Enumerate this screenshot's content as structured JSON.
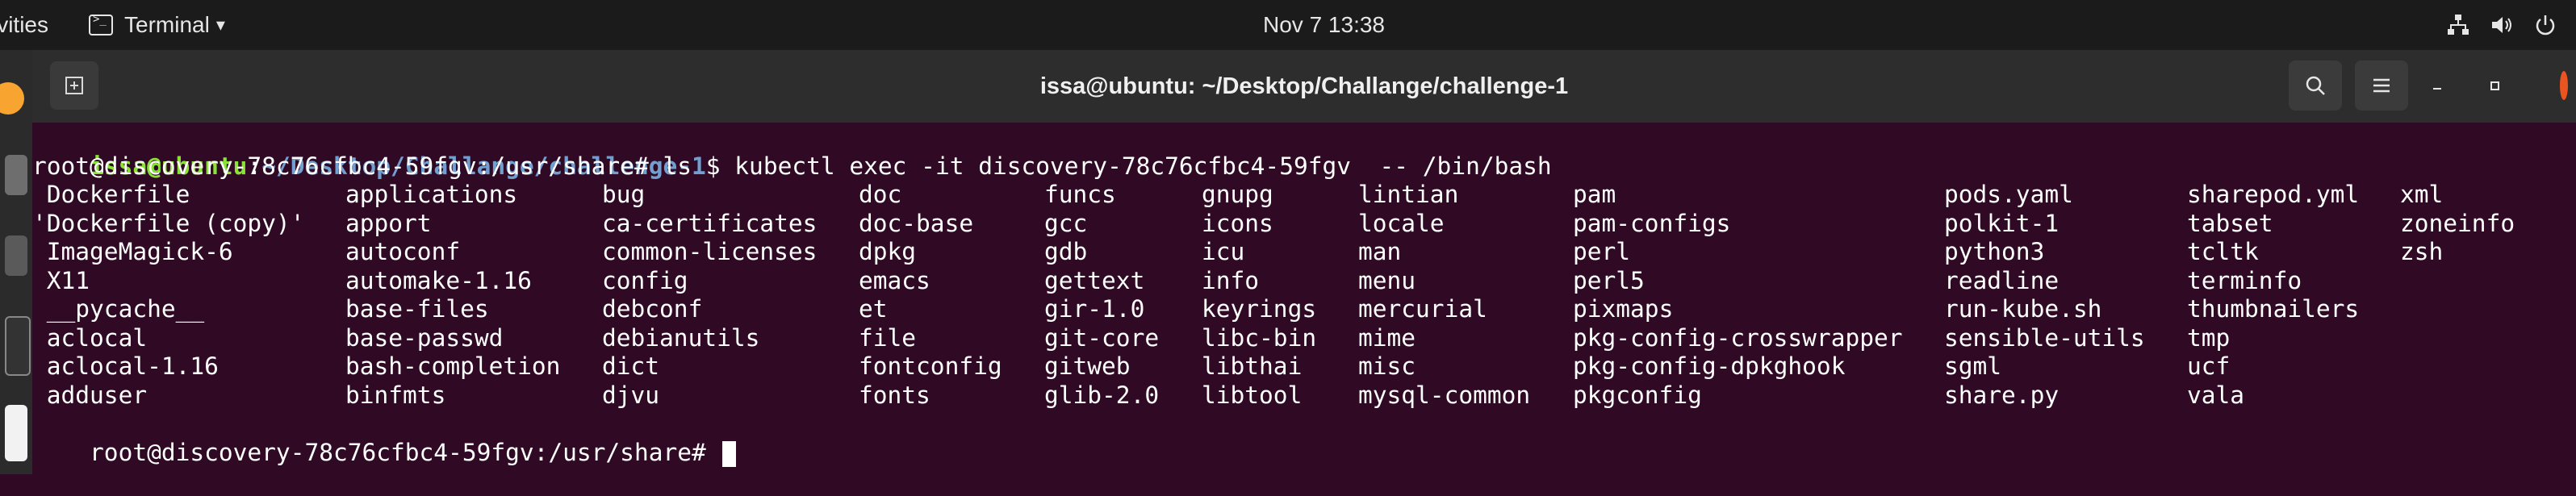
{
  "topbar": {
    "activities": "Activities",
    "app_name": "Terminal",
    "app_menu_arrow": "▾",
    "clock": "Nov 7  13:38",
    "tray_icons": [
      "network-icon",
      "volume-icon",
      "power-icon"
    ]
  },
  "window": {
    "title": "issa@ubuntu: ~/Desktop/Challange/challenge-1",
    "buttons": [
      "new-tab-icon",
      "search-icon",
      "menu-icon",
      "minimize-icon",
      "maximize-icon",
      "close-icon"
    ]
  },
  "terminal": {
    "prompt1": {
      "user_host": "issa@ubuntu",
      "sep": ":",
      "path": "~/Desktop/Challange/challenge-1",
      "symbol": "$",
      "command": " kubectl exec -it discovery-78c76cfbc4-59fgv  -- /bin/bash"
    },
    "prompt2": "root@discovery-78c76cfbc4-59fgv:/usr/share# ls",
    "ls_columns": [
      [
        " Dockerfile",
        "'Dockerfile (copy)'",
        " ImageMagick-6",
        " X11",
        " __pycache__",
        " aclocal",
        " aclocal-1.16",
        " adduser"
      ],
      [
        "applications",
        "apport",
        "autoconf",
        "automake-1.16",
        "base-files",
        "base-passwd",
        "bash-completion",
        "binfmts"
      ],
      [
        "bug",
        "ca-certificates",
        "common-licenses",
        "config",
        "debconf",
        "debianutils",
        "dict",
        "djvu"
      ],
      [
        "doc",
        "doc-base",
        "dpkg",
        "emacs",
        "et",
        "file",
        "fontconfig",
        "fonts"
      ],
      [
        "funcs",
        "gcc",
        "gdb",
        "gettext",
        "gir-1.0",
        "git-core",
        "gitweb",
        "glib-2.0"
      ],
      [
        "gnupg",
        "icons",
        "icu",
        "info",
        "keyrings",
        "libc-bin",
        "libthai",
        "libtool"
      ],
      [
        "lintian",
        "locale",
        "man",
        "menu",
        "mercurial",
        "mime",
        "misc",
        "mysql-common"
      ],
      [
        "pam",
        "pam-configs",
        "perl",
        "perl5",
        "pixmaps",
        "pkg-config-crosswrapper",
        "pkg-config-dpkghook",
        "pkgconfig"
      ],
      [
        "pods.yaml",
        "polkit-1",
        "python3",
        "readline",
        "run-kube.sh",
        "sensible-utils",
        "sgml",
        "share.py"
      ],
      [
        "sharepod.yml",
        "tabset",
        "tcltk",
        "terminfo",
        "thumbnailers",
        "tmp",
        "ucf",
        "vala"
      ],
      [
        "xml",
        "zoneinfo",
        "zsh"
      ]
    ],
    "prompt3": "root@discovery-78c76cfbc4-59fgv:/usr/share# "
  }
}
